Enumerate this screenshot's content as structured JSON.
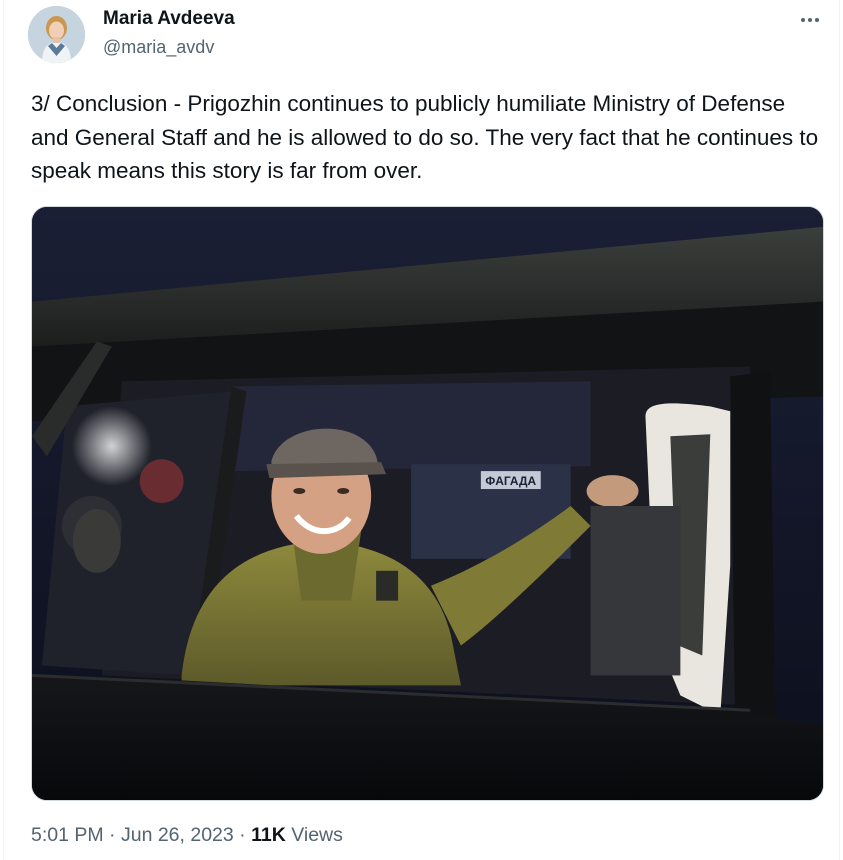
{
  "author": {
    "name": "Maria Avdeeva",
    "handle": "@maria_avdv"
  },
  "tweet": {
    "text": "3/ Conclusion - Prigozhin continues to publicly humiliate Ministry of Defense and General Staff and he is allowed to do so. The very fact that he continues to speak means this story is far from over."
  },
  "media": {
    "sign_text": "ΦАГАДА"
  },
  "meta": {
    "time": "5:01 PM",
    "separator": "·",
    "date": "Jun 26, 2023",
    "views_count": "11K",
    "views_label": "Views"
  },
  "icons": {
    "more": "more-horizontal-icon"
  },
  "colors": {
    "text_primary": "#0f1419",
    "text_secondary": "#536471",
    "border": "#cfd9de"
  }
}
